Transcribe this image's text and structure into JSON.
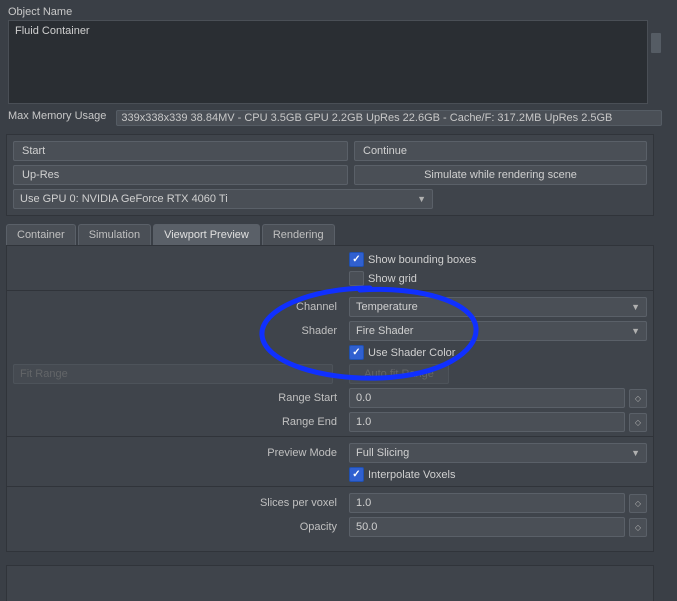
{
  "objectNameLabel": "Object Name",
  "objectNameValue": "Fluid Container",
  "maxMemoryLabel": "Max Memory Usage",
  "maxMemoryValue": "339x338x339 38.84MV - CPU 3.5GB GPU 2.2GB UpRes 22.6GB - Cache/F: 317.2MB UpRes 2.5GB",
  "buttons": {
    "start": "Start",
    "continue": "Continue",
    "upres": "Up-Res",
    "simRender": "Simulate while rendering scene"
  },
  "gpuSelect": "Use GPU 0: NVIDIA GeForce RTX 4060 Ti",
  "tabs": {
    "container": "Container",
    "simulation": "Simulation",
    "viewport": "Viewport Preview",
    "rendering": "Rendering"
  },
  "checks": {
    "showBounding": "Show bounding boxes",
    "showGrid": "Show grid",
    "useShaderColor": "Use Shader Color",
    "interpolateVoxels": "Interpolate Voxels"
  },
  "labels": {
    "channel": "Channel",
    "shader": "Shader",
    "fitRange": "Fit Range",
    "autoFitRange": "Auto fit Range",
    "rangeStart": "Range Start",
    "rangeEnd": "Range End",
    "previewMode": "Preview Mode",
    "slicesPerVoxel": "Slices per voxel",
    "opacity": "Opacity"
  },
  "values": {
    "channel": "Temperature",
    "shader": "Fire Shader",
    "rangeStart": "0.0",
    "rangeEnd": "1.0",
    "previewMode": "Full Slicing",
    "slicesPerVoxel": "1.0",
    "opacity": "50.0"
  }
}
